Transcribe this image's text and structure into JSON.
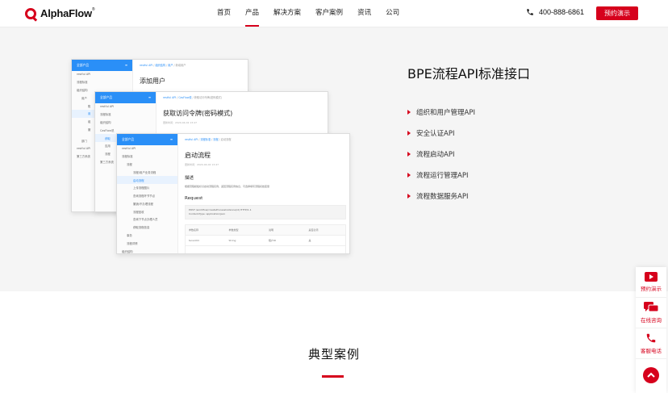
{
  "brand": {
    "name": "AlphaFlow",
    "mark": "®"
  },
  "nav": {
    "items": [
      {
        "label": "首页"
      },
      {
        "label": "产品",
        "active": true
      },
      {
        "label": "解决方案"
      },
      {
        "label": "客户案例"
      },
      {
        "label": "资讯"
      },
      {
        "label": "公司"
      }
    ]
  },
  "header": {
    "phone": "400-888-6861",
    "demo_button": "预约演示"
  },
  "colors": {
    "accent": "#d6001c",
    "panel_blue": "#2a8ff7",
    "band_bg": "#f5f5f5"
  },
  "screens": {
    "s1": {
      "side_head": "全部产品",
      "side": [
        "restful API",
        "流程标准",
        "组织结构",
        "用户",
        "账",
        "用",
        "组",
        "服",
        "",
        "部门",
        "restful API",
        "第三方系统"
      ],
      "crumb": [
        "restful API",
        "组织结构",
        "用户",
        "新增用户"
      ],
      "title": "添加用户"
    },
    "s2": {
      "side_head": "全部产品",
      "side": [
        "restful API",
        "流程标准",
        "组织结构",
        "CasFlow说",
        "获取",
        "应用",
        "流程",
        "第三方系统"
      ],
      "crumb": [
        "restful API",
        "CasFlow说",
        "获取访问令牌(密码模式)"
      ],
      "title": "获取访问令牌(密码模式)",
      "meta": "更新时间：2024-04-02 13:47"
    },
    "s3": {
      "side_head": "全部产品",
      "side": [
        "restful API",
        "流程标准",
        "流程",
        "流程/用户业务流程",
        "启动流程",
        "上传流程图片",
        "查询流程环节节点",
        "撤销/不办理流程",
        "流程回收",
        "查询下节点办理人员",
        "获取流程信息",
        "事务",
        "流程详情",
        "组织结构"
      ],
      "crumb": [
        "restful API",
        "流程标准",
        "流程",
        "启动流程"
      ],
      "title": "启动流程",
      "meta": "更新时间：2024-04-02 13:47",
      "h_desc": "描述",
      "desc": "根据流程模板标识启动流程实例，返回流程实例信息，可选择填写流程初始变量",
      "h_req": "Request",
      "code1": "POST /workflow/createProcessInstance(id) HTTP/1.1",
      "code2": "Content-Type: application/json",
      "table_head": [
        "参数名称",
        "参数类型",
        "说明",
        "是否必须"
      ],
      "table_row": [
        "tenantId",
        "String",
        "租户ID",
        "是"
      ]
    }
  },
  "api_panel": {
    "title": "BPE流程API标准接口",
    "features": [
      "组织和用户管理API",
      "安全认证API",
      "流程启动API",
      "流程运行管理API",
      "流程数据服务API"
    ]
  },
  "cases": {
    "title": "典型案例"
  },
  "float_bar": {
    "items": [
      {
        "label": "预约演示",
        "icon": "video-play-icon"
      },
      {
        "label": "在线咨询",
        "icon": "chat-bubble-icon"
      },
      {
        "label": "客服电话",
        "icon": "phone-icon"
      }
    ],
    "top_icon": "back-to-top-icon"
  }
}
